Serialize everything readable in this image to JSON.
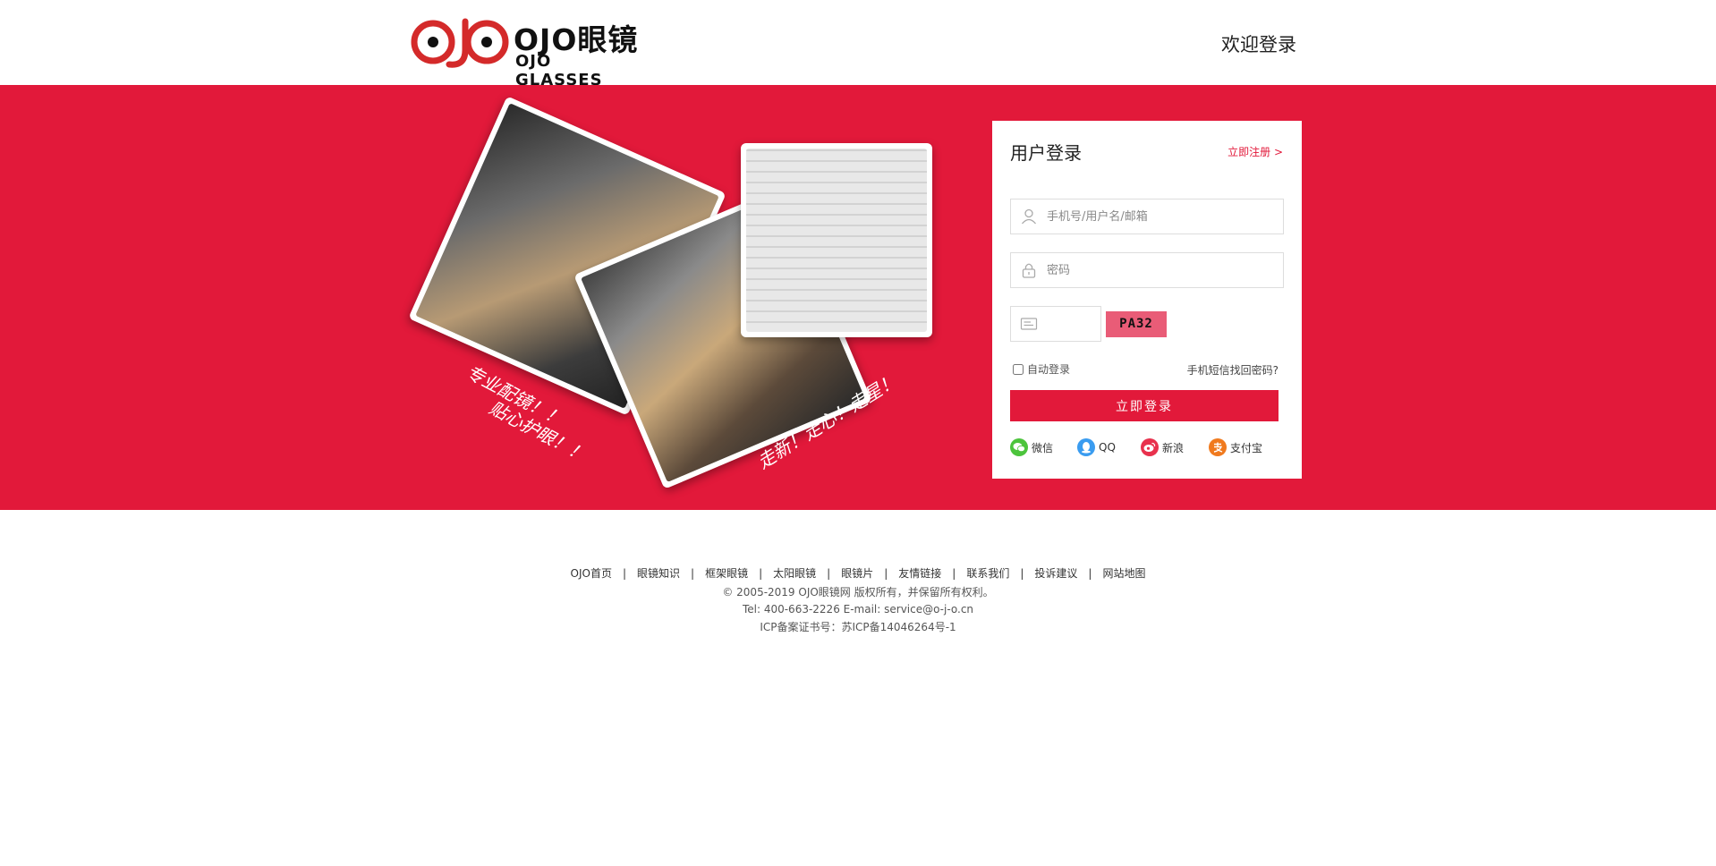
{
  "header": {
    "logo_cn": "OJO眼镜",
    "logo_en": "OJO GLASSES",
    "welcome": "欢迎登录"
  },
  "banner": {
    "slogan_1": "专业配镜！！",
    "slogan_2": "贴心护眼！！",
    "slogan_3": "走新！走心！走星！"
  },
  "login": {
    "title": "用户登录",
    "register_link": "立即注册 >",
    "username_placeholder": "手机号/用户名/邮箱",
    "password_placeholder": "密码",
    "captcha_placeholder": "",
    "captcha_code": "PA32",
    "auto_login_label": "自动登录",
    "forgot_link": "手机短信找回密码?",
    "submit_label": "立即登录",
    "social": [
      {
        "label": "微信",
        "icon": "wechat-icon"
      },
      {
        "label": "QQ",
        "icon": "qq-icon"
      },
      {
        "label": "新浪",
        "icon": "weibo-icon"
      },
      {
        "label": "支付宝",
        "icon": "alipay-icon"
      }
    ]
  },
  "footer": {
    "nav": [
      "OJO首页",
      "眼镜知识",
      "框架眼镜",
      "太阳眼镜",
      "眼镜片",
      "友情链接",
      "联系我们",
      "投诉建议",
      "网站地图"
    ],
    "copyright": "© 2005-2019 OJO眼镜网 版权所有，并保留所有权利。",
    "contact": "Tel: 400-663-2226 E-mail: service@o-j-o.cn",
    "icp": "ICP备案证书号：苏ICP备14046264号-1"
  },
  "colors": {
    "brand_red": "#e2193a",
    "captcha_bg": "#e95c77"
  }
}
